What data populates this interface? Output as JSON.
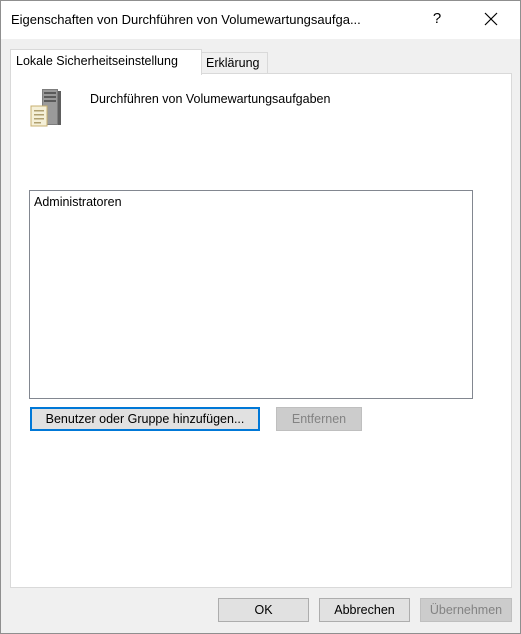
{
  "window": {
    "title": "Eigenschaften von Durchführen von Volumewartungsaufga...",
    "help_label": "?"
  },
  "tabs": [
    {
      "label": "Lokale Sicherheitseinstellung",
      "active": true
    },
    {
      "label": "Erklärung",
      "active": false
    }
  ],
  "policy": {
    "icon": "server-icon",
    "name": "Durchführen von Volumewartungsaufgaben"
  },
  "members": [
    "Administratoren"
  ],
  "buttons": {
    "add": "Benutzer oder Gruppe hinzufügen...",
    "remove": "Entfernen",
    "ok": "OK",
    "cancel": "Abbrechen",
    "apply": "Übernehmen"
  },
  "colors": {
    "focus_accent": "#0078d7",
    "dialog_background": "#f0f0f0",
    "disabled_text": "#838383"
  }
}
